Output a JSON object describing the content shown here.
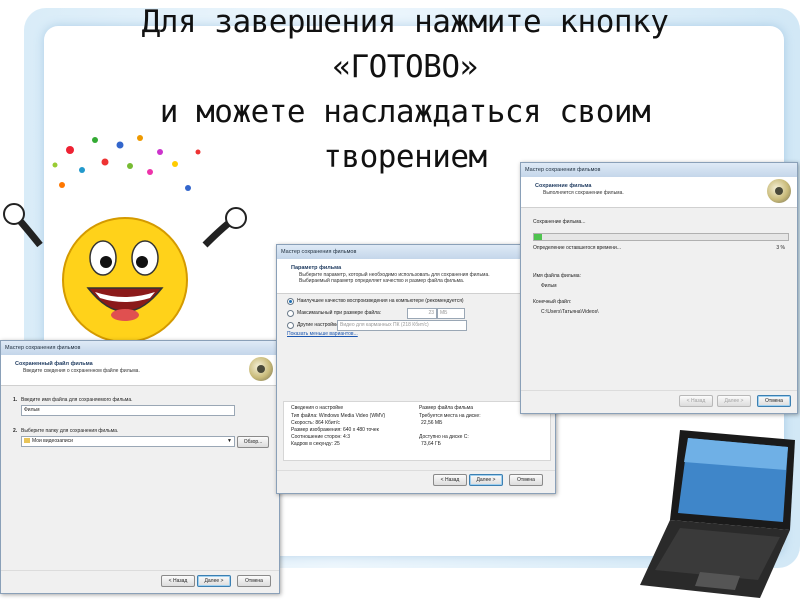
{
  "slide": {
    "title_lines": [
      "Для завершения нажмите кнопку",
      "«ГОТОВО»",
      "и можете наслаждаться своим",
      "творением"
    ]
  },
  "dialog1": {
    "titlebar": "Мастер сохранения фильмов",
    "header_title": "Сохраненный файл фильма",
    "header_sub": "Введите сведения о сохраненном файле фильма.",
    "step1_label": "Введите имя файла для сохраняемого фильма.",
    "step1_num": "1.",
    "filename_value": "Фильм",
    "step2_label": "Выберите папку для сохранения фильма.",
    "step2_num": "2.",
    "folder_value": "Мои видеозаписи",
    "browse_label": "Обзор...",
    "back_label": "< Назад",
    "next_label": "Далее >",
    "cancel_label": "Отмена"
  },
  "dialog2": {
    "titlebar": "Мастер сохранения фильмов",
    "header_title": "Параметр фильма",
    "header_sub1": "Выберите параметр, который необходимо использовать для сохранения фильма.",
    "header_sub2": "Выбираемый параметр определяет качество и размер файла фильма.",
    "opt1": "Наилучшее качество воспроизведения на компьютере (рекомендуется)",
    "opt2": "Максимальный при размере файла:",
    "opt2_value": "23",
    "opt2_unit": "МБ",
    "opt3": "Другие настройки:",
    "opt3_value": "Видео для карманных ПК (218 Кбит/с)",
    "more_link": "Показать меньше вариантов...",
    "settings_heading": "Сведения о настройке",
    "settings_lines": [
      "Тип файла: Windows Media Video (WMV)",
      "Скорость: 864 Кбит/с",
      "Размер изображения: 640 x 480 точек",
      "Соотношение сторон: 4:3",
      "Кадров в секунду: 25"
    ],
    "size_heading": "Размер файла фильма",
    "size_required_label": "Требуется места на диске:",
    "size_required_value": "22,56 МБ",
    "size_available_label": "Доступно на диске C:",
    "size_available_value": "73,64 ГБ",
    "back_label": "< Назад",
    "next_label": "Далее >",
    "cancel_label": "Отмена"
  },
  "dialog3": {
    "titlebar": "Мастер сохранения фильмов",
    "header_title": "Сохранение фильма",
    "header_sub": "Выполняется сохранение фильма.",
    "saving_label": "Сохранение фильма...",
    "progress": 0.03,
    "remaining_label": "Определение оставшегося времени...",
    "percent_label": "3 %",
    "movie_name_label": "Имя файла фильма:",
    "movie_name_value": "Фильм",
    "dest_label": "Конечный файл:",
    "dest_value": "C:\\Users\\Татьяна\\Videos\\",
    "back_label": "< Назад",
    "next_label": "Далее >",
    "cancel_label": "Отмена"
  },
  "colors": {
    "accent": "#1d6fb5",
    "progress_green": "#4fc34f"
  }
}
